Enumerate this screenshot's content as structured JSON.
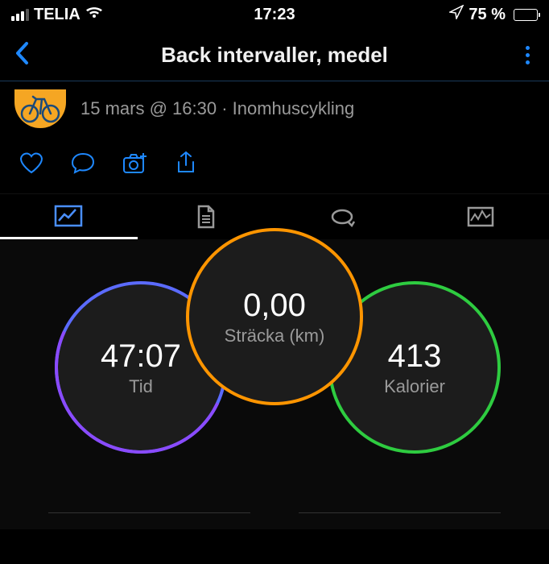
{
  "status": {
    "carrier": "TELIA",
    "time": "17:23",
    "battery_text": "75 %"
  },
  "nav": {
    "title": "Back intervaller, medel"
  },
  "activity": {
    "meta": "15 mars @ 16:30 · Inomhuscykling"
  },
  "metrics": {
    "center": {
      "value": "0,00",
      "label": "Sträcka (km)"
    },
    "left": {
      "value": "47:07",
      "label": "Tid"
    },
    "right": {
      "value": "413",
      "label": "Kalorier"
    }
  }
}
